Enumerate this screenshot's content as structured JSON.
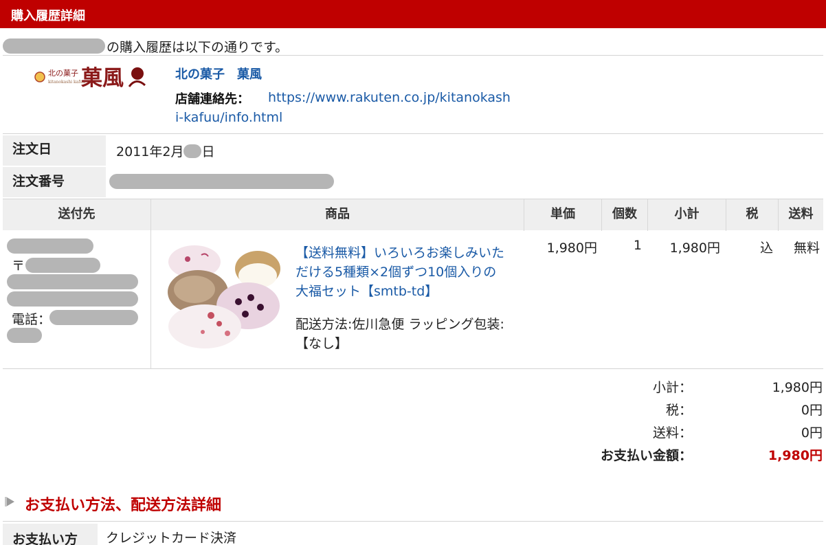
{
  "header": {
    "title": "購入履歴詳細"
  },
  "intro": {
    "text": "の購入履歴は以下の通りです。"
  },
  "shop": {
    "logo_text_small": "北の菓子",
    "logo_text_large": "菓風",
    "name": "北の菓子　菓風",
    "contact_label": "店舗連絡先：",
    "contact_url": "https://www.rakuten.co.jp/kitanokashi-kafuu/info.html"
  },
  "order": {
    "date_label": "注文日",
    "date_value_prefix": "2011年2月",
    "date_value_suffix": "日",
    "number_label": "注文番号"
  },
  "table": {
    "headers": [
      "送付先",
      "商品",
      "単価",
      "個数",
      "小計",
      "税",
      "送料"
    ],
    "row": {
      "postal_mark": "〒",
      "phone_label": "電話：",
      "product_name": "【送料無料】いろいろお楽しみいただける5種類×2個ずつ10個入りの大福セット【smtb-td】",
      "delivery_info": "配送方法:佐川急便 ラッピング包装:【なし】",
      "unit_price": "1,980円",
      "quantity": "1",
      "subtotal": "1,980円",
      "tax": "込",
      "shipping": "無料"
    }
  },
  "summary": {
    "subtotal_label": "小計：",
    "subtotal_value": "1,980円",
    "tax_label": "税：",
    "tax_value": "0円",
    "shipping_label": "送料：",
    "shipping_value": "0円",
    "total_label": "お支払い金額：",
    "total_value": "1,980円"
  },
  "payment_section": {
    "title": "お支払い方法、配送方法詳細",
    "method_label": "お支払い方",
    "method_value": "クレジットカード決済"
  },
  "colors": {
    "accent": "#bf0000",
    "link": "#1a5aa6",
    "label_bg": "#efefef",
    "redaction": "#b5b5b5"
  }
}
